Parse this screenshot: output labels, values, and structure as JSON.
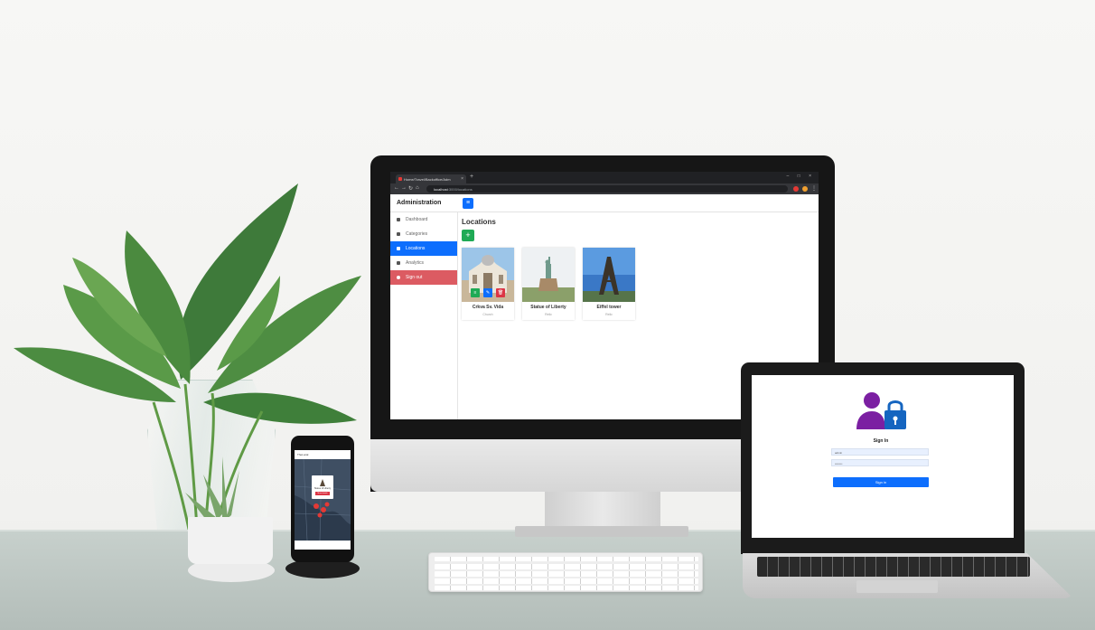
{
  "browser": {
    "tab_title": "Home/Travel/Backoffice/Adm",
    "tab_close": "×",
    "new_tab": "+",
    "window_controls": "–  □  ×",
    "url_host": "localhost",
    "url_path": ":3000/locations"
  },
  "admin": {
    "brand": "Administration",
    "menu_icon": "≡",
    "sidebar": [
      {
        "label": "Dashboard",
        "icon": "home-icon"
      },
      {
        "label": "Categories",
        "icon": "tag-icon"
      },
      {
        "label": "Locations",
        "icon": "map-icon",
        "active": true
      },
      {
        "label": "Analytics",
        "icon": "chart-icon"
      },
      {
        "label": "Sign out",
        "icon": "signout-icon"
      }
    ],
    "page_title": "Locations",
    "add_label": "+",
    "cards": [
      {
        "name": "Crkva Sv. Vida",
        "category": "Church"
      },
      {
        "name": "Statue of Liberty",
        "category": "Relic"
      },
      {
        "name": "Eiffel tower",
        "category": "Relic"
      }
    ],
    "card_actions": {
      "view": "≡",
      "edit": "✎",
      "delete": "🗑"
    }
  },
  "laptop": {
    "title": "Sign In",
    "username_value": "admin",
    "password_value": "••••••••",
    "button_label": "Sign in"
  },
  "phone": {
    "header": "TheLocal",
    "popup_title": "Statue of Liberty",
    "popup_button": "More details"
  },
  "colors": {
    "primary": "#0d6efd",
    "success": "#1faa55",
    "danger": "#dc3545",
    "signout": "#dc5b62",
    "avatar_purple": "#7b1fa2"
  }
}
